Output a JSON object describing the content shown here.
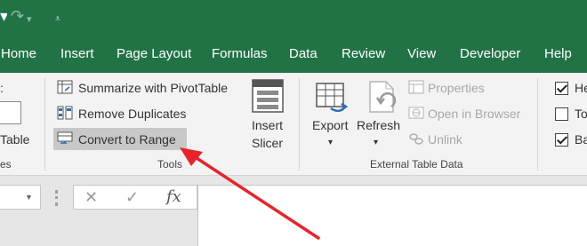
{
  "tabs": [
    "Home",
    "Insert",
    "Page Layout",
    "Formulas",
    "Data",
    "Review",
    "View",
    "Developer",
    "Help"
  ],
  "properties_group": {
    "partial_colon": ":",
    "partial_table_name": "Table",
    "partial_group_label": "es"
  },
  "tools_group": {
    "summarize": "Summarize with PivotTable",
    "remove_duplicates": "Remove Duplicates",
    "convert_to_range": "Convert to Range",
    "insert_slicer_line1": "Insert",
    "insert_slicer_line2": "Slicer",
    "label": "Tools"
  },
  "external_group": {
    "export": "Export",
    "refresh": "Refresh",
    "properties": "Properties",
    "open_in_browser": "Open in Browser",
    "unlink": "Unlink",
    "label": "External Table Data"
  },
  "style_options": {
    "header_row": "He",
    "total_row": "To",
    "banded_rows": "Ba",
    "header_row_checked": true,
    "total_row_checked": false,
    "banded_rows_checked": true
  },
  "formula_bar": {
    "cancel": "✕",
    "enter": "✓",
    "fx": "fx"
  },
  "annotation": {
    "arrow_color": "#e8232a"
  }
}
